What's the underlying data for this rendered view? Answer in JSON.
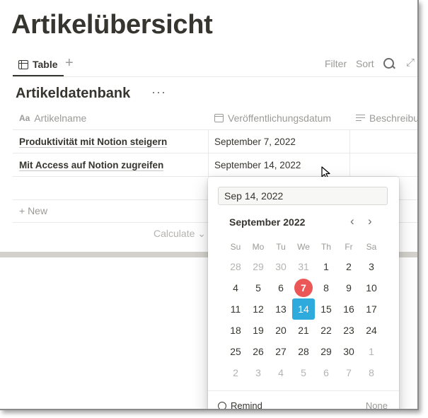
{
  "page": {
    "title": "Artikelübersicht"
  },
  "viewbar": {
    "tab_label": "Table",
    "add_label": "+",
    "filter_label": "Filter",
    "sort_label": "Sort",
    "expand_glyph": "⤢"
  },
  "database": {
    "title": "Artikeldatenbank",
    "more": "···",
    "columns": [
      {
        "icon": "Aa",
        "label": "Artikelname"
      },
      {
        "label": "Veröffentlichungsdatum"
      },
      {
        "label": "Beschreibung"
      }
    ],
    "rows": [
      {
        "name": "Produktivität mit Notion steigern",
        "date": "September 7, 2022"
      },
      {
        "name": "Mit Access auf Notion zugreifen",
        "date": "September 14, 2022"
      }
    ],
    "new_label": "+ New",
    "calculate_label": "Calculate ⌄"
  },
  "datepicker": {
    "input_value": "Sep 14, 2022",
    "month_label": "September 2022",
    "prev": "‹",
    "next": "›",
    "weekdays": [
      "Su",
      "Mo",
      "Tu",
      "We",
      "Th",
      "Fr",
      "Sa"
    ],
    "weeks": [
      [
        "28",
        "29",
        "30",
        "31",
        "1",
        "2",
        "3"
      ],
      [
        "4",
        "5",
        "6",
        "7",
        "8",
        "9",
        "10"
      ],
      [
        "11",
        "12",
        "13",
        "14",
        "15",
        "16",
        "17"
      ],
      [
        "18",
        "19",
        "20",
        "21",
        "22",
        "23",
        "24"
      ],
      [
        "25",
        "26",
        "27",
        "28",
        "29",
        "30",
        "1"
      ],
      [
        "2",
        "3",
        "4",
        "5",
        "6",
        "7",
        "8"
      ]
    ],
    "today": "7",
    "selected": "14",
    "remind_label": "Remind",
    "none_label": "None"
  },
  "colors": {
    "today": "#eb5757",
    "selected": "#2eaadc",
    "text": "#37352f",
    "muted": "#9b9a97"
  }
}
